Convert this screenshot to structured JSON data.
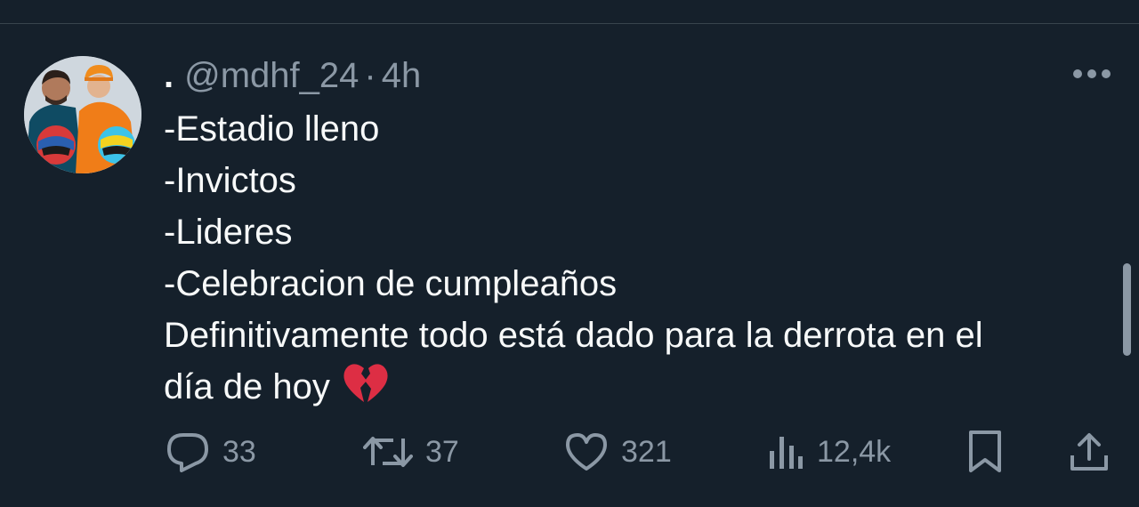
{
  "tweet": {
    "display_name": ".",
    "handle": "@mdhf_24",
    "separator": "·",
    "time": "4h",
    "lines": [
      "-Estadio lleno",
      "-Invictos",
      "-Lideres",
      "-Celebracion de cumpleaños",
      "Definitivamente todo está dado para la derrota en el",
      "día de hoy"
    ],
    "emoji": "broken-heart-emoji"
  },
  "actions": {
    "reply_count": "33",
    "retweet_count": "37",
    "like_count": "321",
    "views_count": "12,4k"
  },
  "icons": {
    "more": "more-horizontal-icon",
    "reply": "reply-icon",
    "retweet": "retweet-icon",
    "like": "heart-icon",
    "views": "views-chart-icon",
    "bookmark": "bookmark-icon",
    "share": "share-icon"
  },
  "colors": {
    "background": "#15202b",
    "text_primary": "#f7f9f9",
    "text_secondary": "#8b98a5",
    "divider": "#38444d"
  }
}
